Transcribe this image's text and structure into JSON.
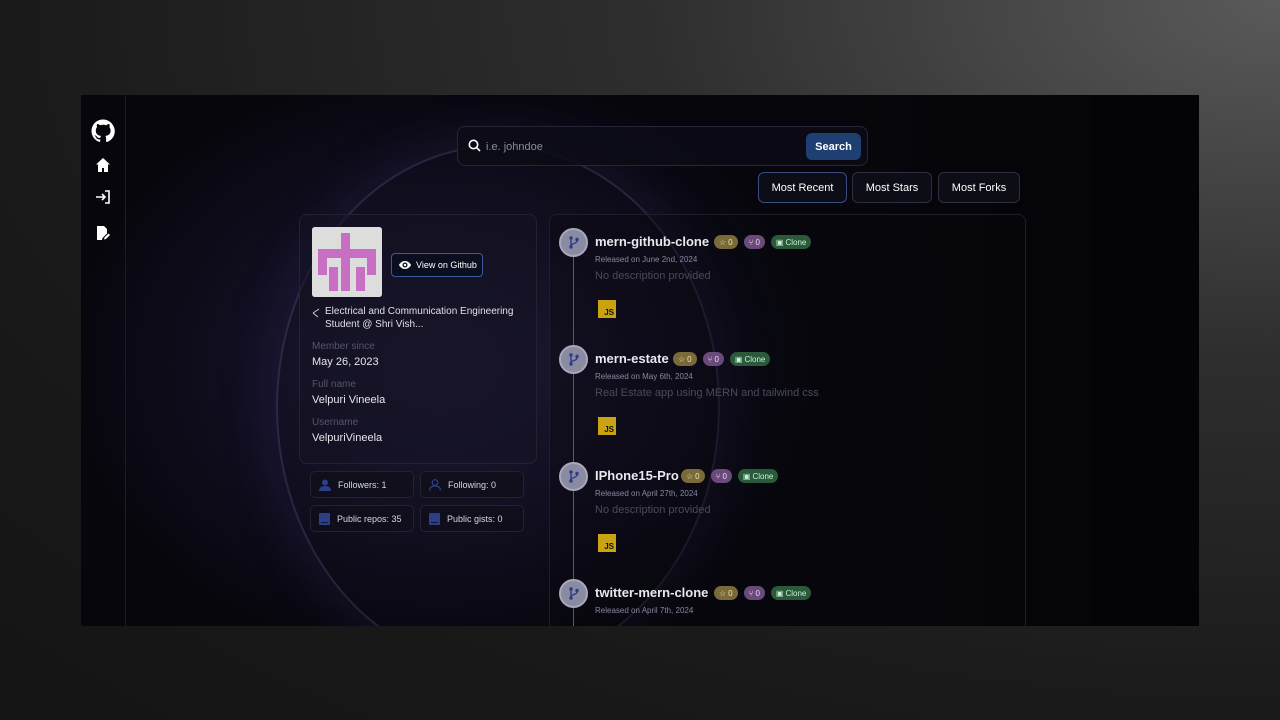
{
  "search": {
    "placeholder": "i.e. johndoe",
    "button_label": "Search"
  },
  "sort": {
    "most_recent": "Most Recent",
    "most_stars": "Most Stars",
    "most_forks": "Most Forks"
  },
  "profile": {
    "view_button": "View on Github",
    "bio": "Electrical and Communication Engineering Student @ Shri Vish...",
    "member_since_label": "Member since",
    "member_since": "May 26, 2023",
    "full_name_label": "Full name",
    "full_name": "Velpuri Vineela",
    "username_label": "Username",
    "username": "VelpuriVineela"
  },
  "stats": {
    "followers": "Followers: 1",
    "following": "Following: 0",
    "public_repos": "Public repos: 35",
    "public_gists": "Public gists: 0"
  },
  "repos": [
    {
      "name": "mern-github-clone",
      "stars": "0",
      "forks": "0",
      "clone": "Clone",
      "released": "Released on June 2nd, 2024",
      "description": "No description provided",
      "lang": "JS"
    },
    {
      "name": "mern-estate",
      "stars": "0",
      "forks": "0",
      "clone": "Clone",
      "released": "Released on May 6th, 2024",
      "description": "Real Estate app using MERN and tailwind css",
      "lang": "JS"
    },
    {
      "name": "IPhone15-Pro",
      "stars": "0",
      "forks": "0",
      "clone": "Clone",
      "released": "Released on April 27th, 2024",
      "description": "No description provided",
      "lang": "JS"
    },
    {
      "name": "twitter-mern-clone",
      "stars": "0",
      "forks": "0",
      "clone": "Clone",
      "released": "Released on April 7th, 2024"
    }
  ],
  "icons": {
    "sidebar": [
      "github-logo-icon",
      "home-icon",
      "login-icon",
      "edit-icon"
    ]
  },
  "colors": {
    "accent": "#1f3f73",
    "star_badge": "#7a6a3a",
    "fork_badge": "#6a4a7a",
    "clone_badge": "#2a5a3a",
    "js": "#c9a312"
  }
}
